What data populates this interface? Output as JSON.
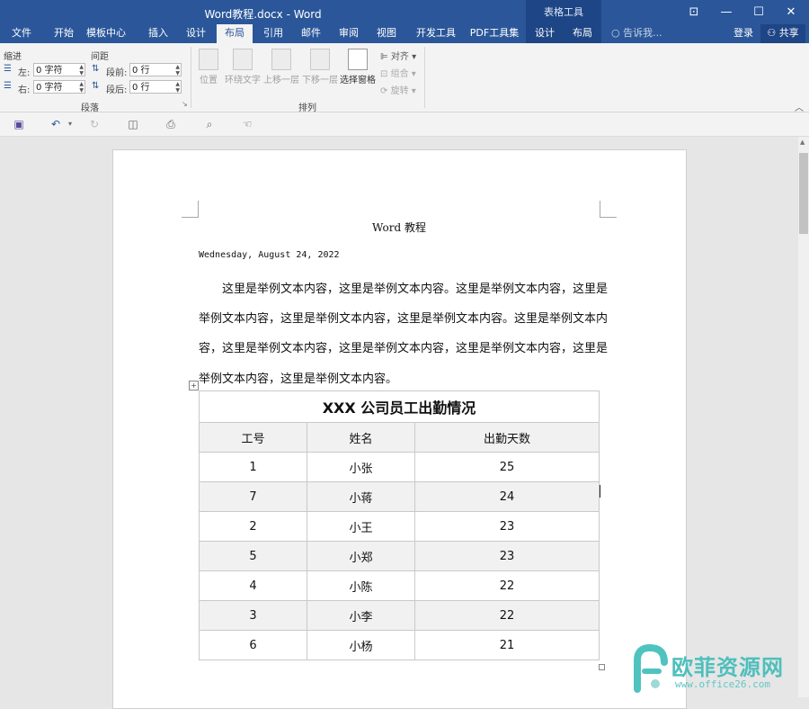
{
  "titlebar": {
    "title": "Word教程.docx - Word",
    "context_group": "表格工具",
    "help_symbol": "⊡",
    "min": "—",
    "max": "☐",
    "close": "✕"
  },
  "tabs": [
    {
      "label": "文件"
    },
    {
      "label": "开始"
    },
    {
      "label": "模板中心"
    },
    {
      "label": "插入"
    },
    {
      "label": "设计"
    },
    {
      "label": "布局",
      "active": true
    },
    {
      "label": "引用"
    },
    {
      "label": "邮件"
    },
    {
      "label": "审阅"
    },
    {
      "label": "视图"
    },
    {
      "label": "开发工具"
    },
    {
      "label": "PDF工具集"
    },
    {
      "label": "设计"
    },
    {
      "label": "布局"
    }
  ],
  "tell_me": "告诉我...",
  "login": "登录",
  "share": "共享",
  "ribbon": {
    "indent_label": "缩进",
    "spacing_label": "间距",
    "left_label": "左:",
    "right_label": "右:",
    "before_label": "段前:",
    "after_label": "段后:",
    "left_value": "0 字符",
    "right_value": "0 字符",
    "before_value": "0 行",
    "after_value": "0 行",
    "paragraph_group": "段落",
    "arrange_group": "排列",
    "position": "位置",
    "wrap_text": "环绕文字",
    "bring_forward": "上移一层",
    "send_backward": "下移一层",
    "selection_pane": "选择窗格",
    "align": "对齐",
    "group": "组合",
    "rotate": "旋转"
  },
  "document": {
    "header_text": "Word 教程",
    "date": "Wednesday, August 24, 2022",
    "paragraph_lines": [
      "　　这里是举例文本内容，这里是举例文本内容。这里是举例文本内容，这里是",
      "举例文本内容，这里是举例文本内容，这里是举例文本内容。这里是举例文本内",
      "容，这里是举例文本内容，这里是举例文本内容，这里是举例文本内容，这里是",
      "举例文本内容，这里是举例文本内容。"
    ],
    "table": {
      "caption": "XXX 公司员工出勤情况",
      "headers": [
        "工号",
        "姓名",
        "出勤天数"
      ],
      "rows": [
        [
          "1",
          "小张",
          "25"
        ],
        [
          "7",
          "小蒋",
          "24"
        ],
        [
          "2",
          "小王",
          "23"
        ],
        [
          "5",
          "小郑",
          "23"
        ],
        [
          "4",
          "小陈",
          "22"
        ],
        [
          "3",
          "小李",
          "22"
        ],
        [
          "6",
          "小杨",
          "21"
        ]
      ]
    }
  },
  "watermark": {
    "brand": "欧菲资源网",
    "url": "www.office26.com"
  },
  "colors": {
    "word_blue": "#2b579a",
    "context_blue": "#1e4585"
  }
}
